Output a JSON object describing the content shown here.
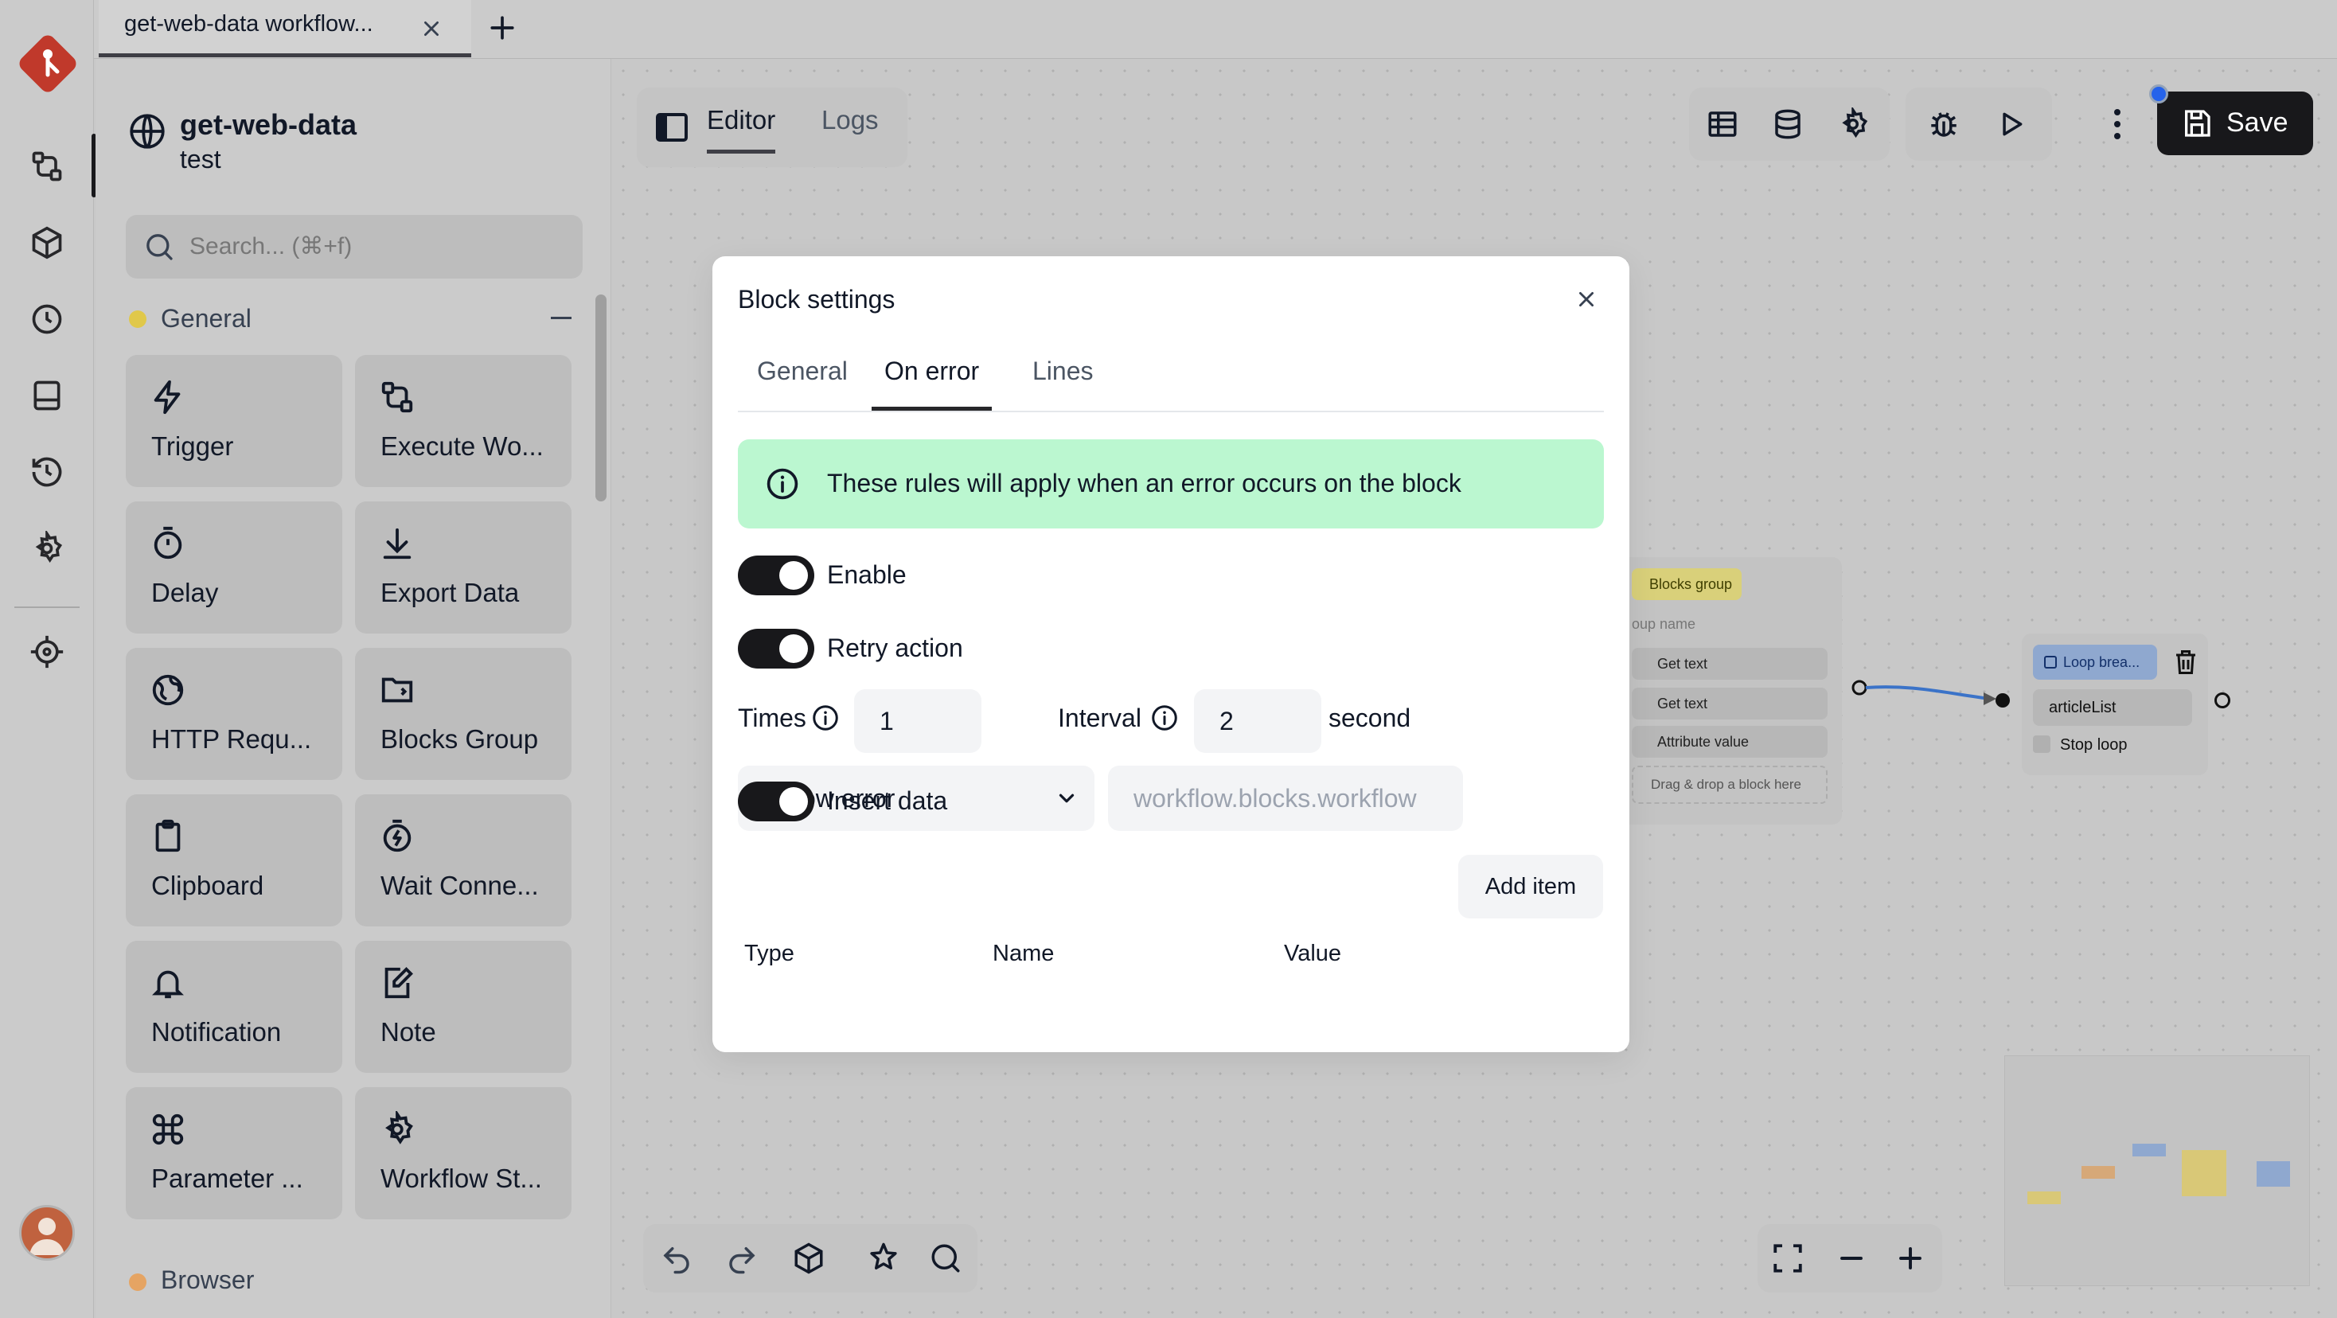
{
  "tabs": {
    "items": [
      {
        "label": "get-web-data workflow..."
      }
    ],
    "new_tab_symbol": "+"
  },
  "rail": {
    "icons": [
      "logo-icon",
      "workflow-icon",
      "package-icon",
      "clock-icon",
      "storage-icon",
      "history-icon",
      "settings-icon",
      "crosshair-icon",
      "user-avatar"
    ]
  },
  "workflow": {
    "name": "get-web-data",
    "description": "test"
  },
  "panel": {
    "search_placeholder": "Search... (⌘+f)",
    "categories": [
      {
        "name": "General",
        "color": "#e0c84a",
        "blocks": [
          {
            "label": "Trigger",
            "icon": "lightning-icon"
          },
          {
            "label": "Execute Wo...",
            "icon": "workflow-icon"
          },
          {
            "label": "Delay",
            "icon": "timer-icon"
          },
          {
            "label": "Export Data",
            "icon": "download-icon"
          },
          {
            "label": "HTTP Requ...",
            "icon": "globe-icon"
          },
          {
            "label": "Blocks Group",
            "icon": "folder-icon"
          },
          {
            "label": "Clipboard",
            "icon": "clipboard-icon"
          },
          {
            "label": "Wait Conne...",
            "icon": "stopwatch-icon"
          },
          {
            "label": "Notification",
            "icon": "bell-icon"
          },
          {
            "label": "Note",
            "icon": "note-icon"
          },
          {
            "label": "Parameter ...",
            "icon": "command-icon"
          },
          {
            "label": "Workflow St...",
            "icon": "gear-icon"
          }
        ]
      },
      {
        "name": "Browser",
        "color": "#e5a463"
      }
    ]
  },
  "editor": {
    "tabs": [
      {
        "label": "Editor",
        "active": true
      },
      {
        "label": "Logs",
        "active": false
      }
    ],
    "save_label": "Save"
  },
  "canvas": {
    "group_block": {
      "tag": "Blocks group",
      "name_placeholder": "oup name",
      "items": [
        "Get text",
        "Get text",
        "Attribute value"
      ],
      "drop_hint": "Drag & drop a block here"
    },
    "loop_block": {
      "tag": "Loop brea...",
      "input_value": "articleList",
      "checkbox_label": "Stop loop"
    }
  },
  "modal": {
    "title": "Block settings",
    "tabs": [
      {
        "label": "General",
        "active": false
      },
      {
        "label": "On error",
        "active": true
      },
      {
        "label": "Lines",
        "active": false
      }
    ],
    "alert": "These rules will apply when an error occurs on the block",
    "alert_color": "#bbf7d0",
    "enable_label": "Enable",
    "enable_on": true,
    "retry_label": "Retry action",
    "retry_on": true,
    "times_label": "Times",
    "times_value": "1",
    "interval_label": "Interval",
    "interval_value": "2",
    "interval_unit": "second",
    "action_selected": "Throw error",
    "fallback_placeholder": "workflow.blocks.workflow",
    "insert_data_label": "Insert data",
    "insert_data_on": true,
    "add_item_label": "Add item",
    "table_headers": [
      "Type",
      "Name",
      "Value"
    ]
  }
}
